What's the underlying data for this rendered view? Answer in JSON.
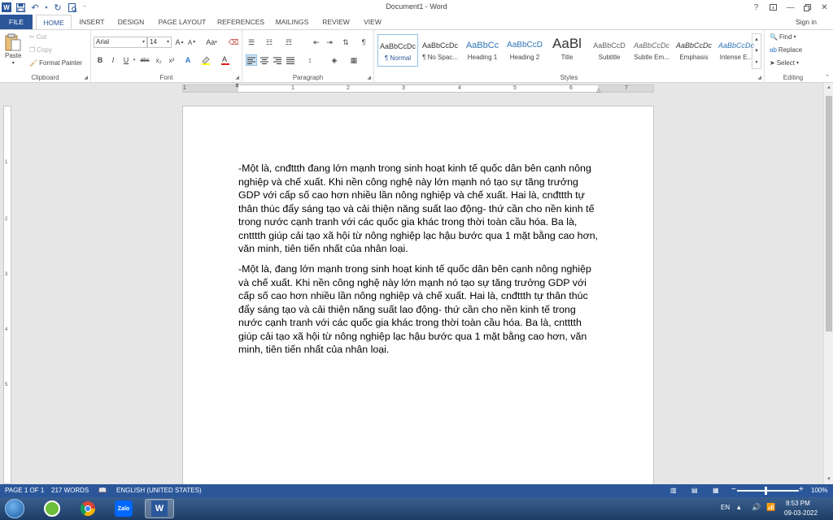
{
  "window": {
    "title": "Document1 - Word",
    "help": "?",
    "buttons": [
      "ribbon-display-options",
      "minimize",
      "restore",
      "close"
    ]
  },
  "quick_access": [
    "word-logo",
    "save-icon",
    "undo-icon",
    "redo-icon",
    "print-preview-icon",
    "customize-qat-icon"
  ],
  "tabs": {
    "file": "FILE",
    "items": [
      "HOME",
      "INSERT",
      "DESIGN",
      "PAGE LAYOUT",
      "REFERENCES",
      "MAILINGS",
      "REVIEW",
      "VIEW"
    ],
    "active": "HOME",
    "signin": "Sign in"
  },
  "ribbon": {
    "clipboard": {
      "label": "Clipboard",
      "paste": "Paste",
      "cut": "Cut",
      "copy": "Copy",
      "format_painter": "Format Painter"
    },
    "font": {
      "label": "Font",
      "name": "Arial",
      "size": "14",
      "bold": "B",
      "italic": "I",
      "underline": "U",
      "strike": "abc",
      "subscript": "x₂",
      "superscript": "x²",
      "case": "Aa",
      "grow": "A",
      "shrink": "A"
    },
    "paragraph": {
      "label": "Paragraph",
      "show_marks": "¶"
    },
    "styles": {
      "label": "Styles",
      "items": [
        {
          "preview": "AaBbCcDc",
          "name": "¶ Normal"
        },
        {
          "preview": "AaBbCcDc",
          "name": "¶ No Spac..."
        },
        {
          "preview": "AaBbCc",
          "name": "Heading 1"
        },
        {
          "preview": "AaBbCcD",
          "name": "Heading 2"
        },
        {
          "preview": "AaBl",
          "name": "Title"
        },
        {
          "preview": "AaBbCcD",
          "name": "Subtitle"
        },
        {
          "preview": "AaBbCcDc",
          "name": "Subtle Em..."
        },
        {
          "preview": "AaBbCcDc",
          "name": "Emphasis"
        },
        {
          "preview": "AaBbCcDc",
          "name": "Intense E..."
        }
      ],
      "selected": 0
    },
    "editing": {
      "label": "Editing",
      "find": "Find",
      "replace": "Replace",
      "select": "Select"
    }
  },
  "ruler": {
    "numbers": [
      "1",
      "1",
      "2",
      "3",
      "4",
      "5",
      "6",
      "7"
    ]
  },
  "vruler": {
    "numbers": [
      "1",
      "2",
      "3",
      "4",
      "5"
    ]
  },
  "document": {
    "paragraphs": [
      "-Một là, cnđttth đang lớn mạnh trong sinh hoạt kinh tế quốc dân bên cạnh nông nghiệp và chế xuất. Khi nền công nghệ này lớn mạnh nó tạo sự tăng trưởng GDP với cấp số cao hơn nhiều lần nông nghiệp và chế xuất. Hai là, cnđttth tự thân thúc đẩy sáng tạo và cải thiện năng suất lao động- thứ cần cho nền kinh tế trong nước cạnh tranh với các quốc gia khác trong thời toàn cầu hóa. Ba là, cntttth giúp cải tạo xã hội từ nông nghiệp lạc hậu bước qua 1 mặt bằng cao hơn, văn minh, tiên tiến nhất của nhân loại.",
      "-Một là, đang lớn mạnh trong sinh hoạt kinh tế quốc dân bên cạnh nông nghiệp và chế xuất. Khi nền công nghệ này lớn mạnh nó tạo sự tăng trưởng GDP với cấp số cao hơn nhiều lần nông nghiệp và chế xuất. Hai là, cnđttth tự thân thúc đẩy sáng tạo và cải thiện năng suất lao động- thứ cần cho nền kinh tế trong nước cạnh tranh với các quốc gia khác trong thời toàn cầu hóa. Ba là, cntttth giúp cải tạo xã hội từ nông nghiệp lạc hậu bước qua 1 mặt bằng cao hơn, văn minh, tiên tiến nhất của nhân loại."
    ]
  },
  "status": {
    "page": "PAGE 1 OF 1",
    "words": "217 WORDS",
    "language": "ENGLISH (UNITED STATES)",
    "zoom": "100%",
    "zoom_in": "+",
    "zoom_out": "−"
  },
  "taskbar": {
    "apps": [
      "start-orb",
      "zalo-green-icon",
      "chrome-icon",
      "zalo-icon",
      "word-icon"
    ],
    "active_app": "word-icon",
    "language": "EN",
    "time": "8:53 PM",
    "date": "09-03-2022"
  },
  "colors": {
    "accent": "#2b579a",
    "ribbon_bg": "#ffffff",
    "workspace_bg": "#e6e6e6",
    "spellcheck": "#e02020"
  }
}
